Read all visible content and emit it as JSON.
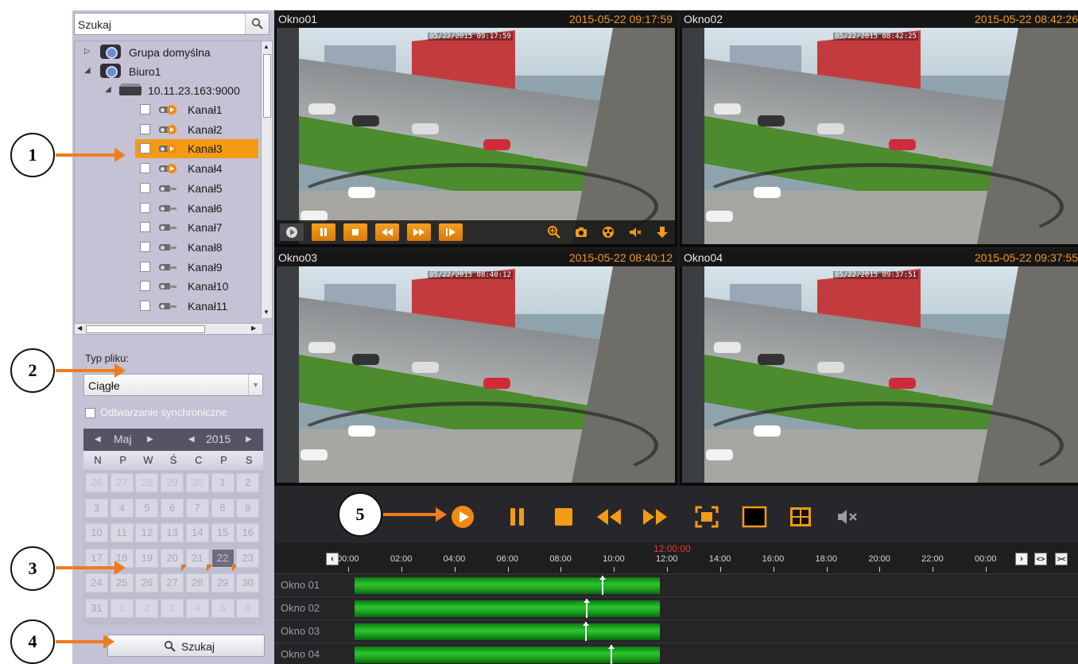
{
  "search": {
    "placeholder": "Szukaj"
  },
  "tree": {
    "groups": [
      "Grupa domyślna",
      "Biuro1"
    ],
    "device": "10.11.23.163:9000",
    "channels": [
      "Kanał1",
      "Kanał2",
      "Kanał3",
      "Kanał4",
      "Kanał5",
      "Kanał6",
      "Kanał7",
      "Kanał8",
      "Kanał9",
      "Kanał10",
      "Kanał11"
    ],
    "selected_channel": "Kanał3"
  },
  "file_type": {
    "label": "Typ pliku:",
    "value": "Ciągłe"
  },
  "sync_playback": {
    "label": "Odtwarzanie synchroniczne",
    "checked": false
  },
  "calendar": {
    "month": "Maj",
    "year": "2015",
    "day_names": [
      "N",
      "P",
      "W",
      "Ś",
      "C",
      "P",
      "S"
    ],
    "weeks": [
      [
        "26",
        "27",
        "28",
        "29",
        "30",
        "1",
        "2"
      ],
      [
        "3",
        "4",
        "5",
        "6",
        "7",
        "8",
        "9"
      ],
      [
        "10",
        "11",
        "12",
        "13",
        "14",
        "15",
        "16"
      ],
      [
        "17",
        "18",
        "19",
        "20",
        "21",
        "22",
        "23"
      ],
      [
        "24",
        "25",
        "26",
        "27",
        "28",
        "29",
        "30"
      ],
      [
        "31",
        "1",
        "2",
        "3",
        "4",
        "5",
        "6"
      ]
    ],
    "selected_day": "22",
    "marked_days": [
      "20",
      "21",
      "22"
    ]
  },
  "search_button": {
    "label": "Szukaj"
  },
  "windows": [
    {
      "name": "Okno01",
      "timestamp": "2015-05-22 09:17:59",
      "osd": "05/22/2015 09:17:59"
    },
    {
      "name": "Okno02",
      "timestamp": "2015-05-22 08:42:26",
      "osd": "05/22/2015 08:42:25"
    },
    {
      "name": "Okno03",
      "timestamp": "2015-05-22 08:40:12",
      "osd": "05/22/2015 08:40:12"
    },
    {
      "name": "Okno04",
      "timestamp": "2015-05-22 09:37:55",
      "osd": "05/22/2015 09:37:51"
    }
  ],
  "timeline": {
    "current_time": "12:00:00",
    "hours": [
      "00:00",
      "02:00",
      "04:00",
      "06:00",
      "08:00",
      "10:00",
      "12:00",
      "14:00",
      "16:00",
      "18:00",
      "20:00",
      "22:00",
      "00:00"
    ],
    "rows": [
      {
        "label": "Okno 01",
        "record_start": "00:00",
        "record_end": "11:30",
        "playhead": "09:18"
      },
      {
        "label": "Okno 02",
        "record_start": "00:00",
        "record_end": "11:30",
        "playhead": "08:42"
      },
      {
        "label": "Okno 03",
        "record_start": "00:00",
        "record_end": "11:30",
        "playhead": "08:40"
      },
      {
        "label": "Okno 04",
        "record_start": "00:00",
        "record_end": "11:30",
        "playhead": "09:38"
      }
    ]
  },
  "callouts": [
    "1",
    "2",
    "3",
    "4",
    "5"
  ],
  "colors": {
    "accent": "#f49a14",
    "record_bar": "#22b022",
    "callout_arrow": "#ee7c1e",
    "timestamp": "#f29a1a"
  }
}
